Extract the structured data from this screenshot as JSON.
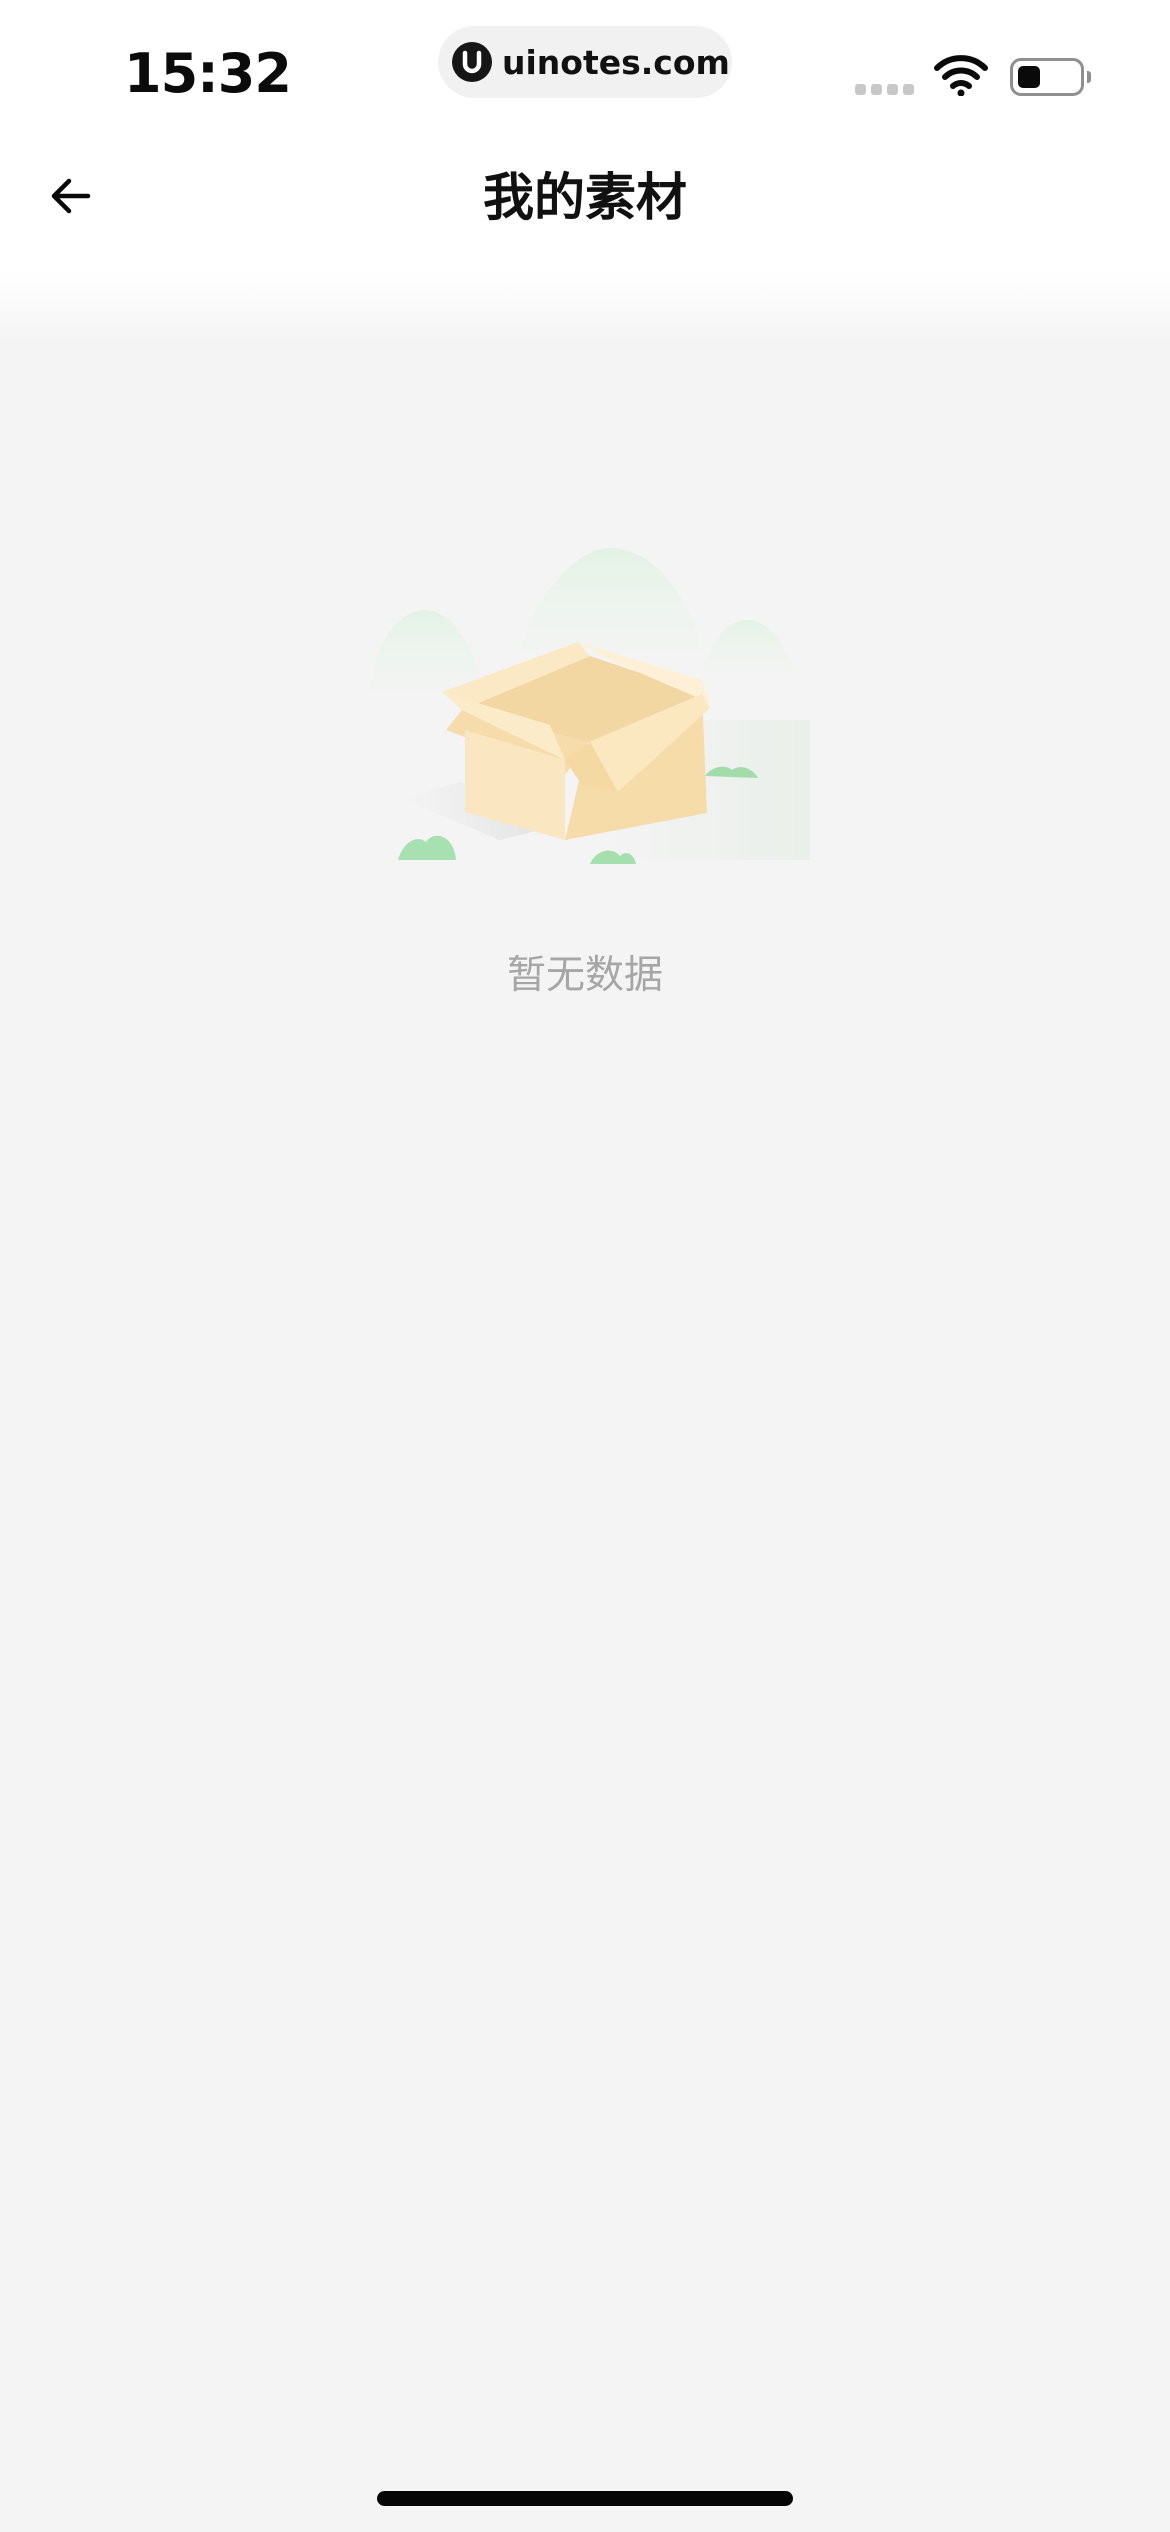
{
  "status_bar": {
    "time": "15:32",
    "url": "uinotes.com",
    "logo_letter": "U",
    "battery_level": 0.35
  },
  "nav": {
    "back_icon": "arrow-left-icon",
    "title": "我的素材"
  },
  "empty_state": {
    "illustration": "empty-box-icon",
    "message": "暂无数据"
  },
  "colors": {
    "background": "#f4f4f4",
    "header": "#ffffff",
    "title": "#111111",
    "empty_text": "#a6a6a6",
    "box": "#f9e3b8",
    "hills": "#e6f3e7",
    "bushes": "#9fdca9"
  }
}
